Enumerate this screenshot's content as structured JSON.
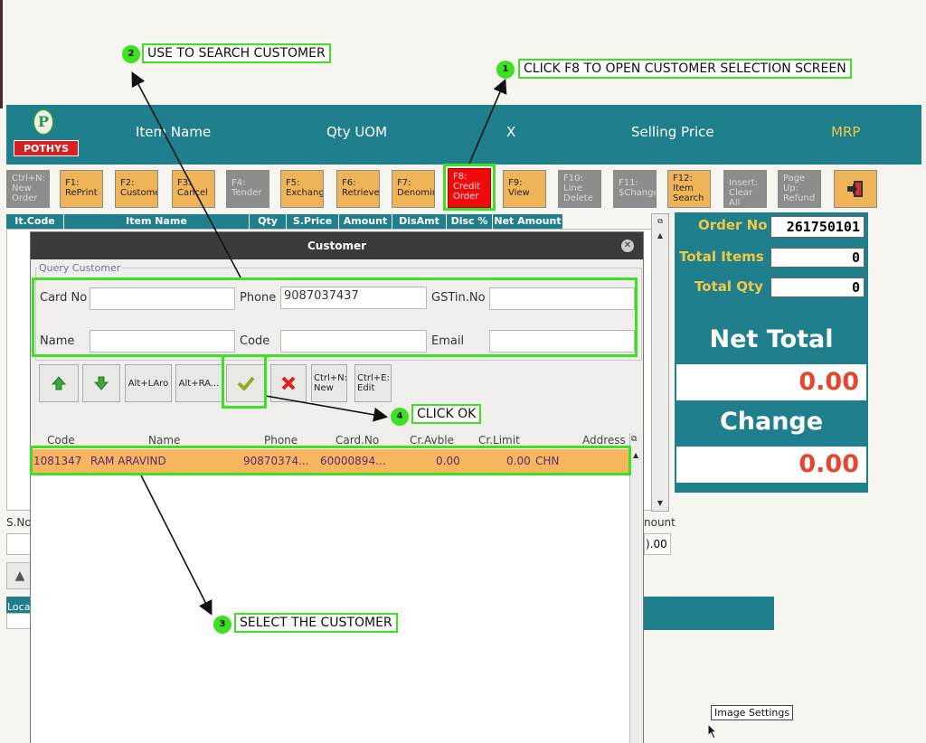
{
  "header": {
    "logo_text": "POTHYS",
    "columns": [
      "Item Name",
      "Qty UOM",
      "X",
      "Selling Price",
      "MRP"
    ],
    "colors": {
      "teal": "#1f7f8c",
      "orange": "#f0b458",
      "accent_yellow": "#f2c744",
      "highlight_green": "#3ee024",
      "value_red": "#e8452e"
    }
  },
  "fkeys": [
    {
      "key": "Ctrl+N:",
      "label": "New Order",
      "state": "off"
    },
    {
      "key": "F1:",
      "label": "RePrint",
      "state": "on"
    },
    {
      "key": "F2:",
      "label": "Custome",
      "state": "on"
    },
    {
      "key": "F3:",
      "label": "Cancel",
      "state": "on"
    },
    {
      "key": "F4:",
      "label": "Tender",
      "state": "off"
    },
    {
      "key": "F5:",
      "label": "Exchang",
      "state": "on"
    },
    {
      "key": "F6:",
      "label": "Retrieve",
      "state": "on"
    },
    {
      "key": "F7:",
      "label": "Denomin",
      "state": "on"
    },
    {
      "key": "F8:",
      "label": "Credit Order",
      "state": "red"
    },
    {
      "key": "F9:",
      "label": "View",
      "state": "on"
    },
    {
      "key": "F10:",
      "label": "Line Delete",
      "state": "off"
    },
    {
      "key": "F11:",
      "label": "$Change",
      "state": "off"
    },
    {
      "key": "F12:",
      "label": "Item Search",
      "state": "on"
    },
    {
      "key": "Insert:",
      "label": "Clear All",
      "state": "off"
    },
    {
      "key": "Page Up:",
      "label": "Refund",
      "state": "off"
    }
  ],
  "grid": {
    "headers": [
      "It.Code",
      "Item Name",
      "Qty",
      "S.Price",
      "Amount",
      "DisAmt",
      "Disc %",
      "Net Amount"
    ]
  },
  "summary": {
    "order_no_label": "Order No",
    "order_no": "261750101",
    "total_items_label": "Total Items",
    "total_items": "0",
    "total_qty_label": "Total Qty",
    "total_qty": "0",
    "net_total_label": "Net Total",
    "net_total": "0.00",
    "change_label": "Change",
    "change": "0.00"
  },
  "background": {
    "sno_label": "S.No",
    "amount_fragment": "nount",
    "amount_value_fragment": ").00",
    "loca_fragment": "Loca"
  },
  "dialog": {
    "title": "Customer",
    "group_title": "Query Customer",
    "fields": {
      "card_no": {
        "label": "Card No",
        "value": ""
      },
      "phone": {
        "label": "Phone",
        "value": "9087037437"
      },
      "gstin": {
        "label": "GSTin.No",
        "value": ""
      },
      "name": {
        "label": "Name",
        "value": ""
      },
      "code": {
        "label": "Code",
        "value": ""
      },
      "email": {
        "label": "Email",
        "value": ""
      }
    },
    "buttons": {
      "alt_left": "Alt+LAro",
      "alt_right": "Alt+RA...",
      "new_key": "Ctrl+N:",
      "new_label": "New",
      "edit_key": "Ctrl+E:",
      "edit_label": "Edit"
    },
    "results": {
      "headers": [
        "Code",
        "Name",
        "Phone",
        "Card.No",
        "Cr.Avble",
        "Cr.Limit",
        "Address"
      ],
      "rows": [
        {
          "code": "1081347",
          "name": "RAM ARAVIND",
          "phone": "90870374...",
          "card_no": "60000894...",
          "cr_avble": "0.00",
          "cr_limit": "0.00",
          "address": "CHN"
        }
      ]
    }
  },
  "annotations": [
    {
      "num": "1",
      "text": "CLICK F8 TO OPEN CUSTOMER SELECTION SCREEN"
    },
    {
      "num": "2",
      "text": "USE TO SEARCH CUSTOMER"
    },
    {
      "num": "3",
      "text": "SELECT THE CUSTOMER"
    },
    {
      "num": "4",
      "text": "CLICK OK"
    }
  ],
  "tooltip": "Image Settings"
}
